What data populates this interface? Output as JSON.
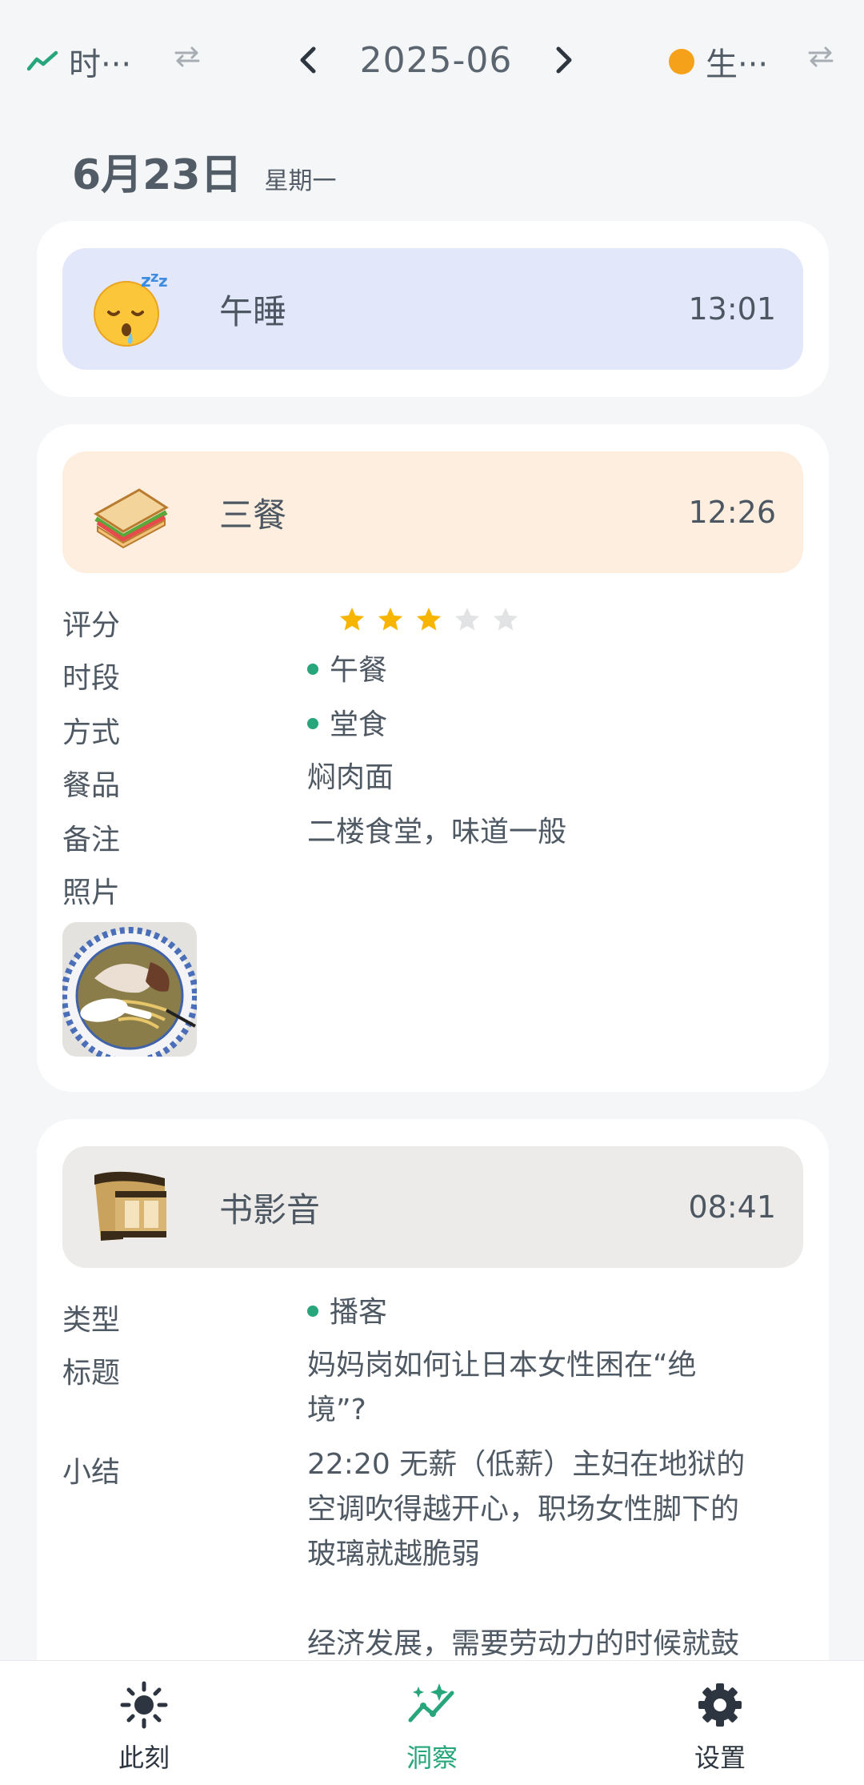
{
  "topbar": {
    "left_label": "时···",
    "month": "2025-06",
    "right_label": "生···",
    "right_dot_color": "#f5a11a",
    "accent": "#27a57b"
  },
  "date": {
    "day": "6月23日",
    "weekday": "星期一"
  },
  "nap": {
    "title": "午睡",
    "time": "13:01",
    "icon": "sleeping-face-emoji",
    "bg": "#e2e7fa"
  },
  "meal": {
    "title": "三餐",
    "time": "12:26",
    "icon": "sandwich-emoji",
    "bg": "#fdeee0",
    "rating_label": "评分",
    "rating": 3,
    "rating_max": 5,
    "period_label": "时段",
    "period": "午餐",
    "mode_label": "方式",
    "mode": "堂食",
    "dish_label": "餐品",
    "dish": "焖肉面",
    "note_label": "备注",
    "note": "二楼食堂，味道一般",
    "photo_label": "照片"
  },
  "media": {
    "title": "书影音",
    "time": "08:41",
    "icon": "film-strip-emoji",
    "bg": "#ecebe9",
    "type_label": "类型",
    "type": "播客",
    "heading_label": "标题",
    "heading_line1": "妈妈岗如何让日本女性困在“绝",
    "heading_line2": "境”?",
    "summary_label": "小结",
    "summary_line1": "22:20 无薪（低薪）主妇在地狱的",
    "summary_line2": "空调吹得越开心，职场女性脚下的",
    "summary_line3": "玻璃就越脆弱",
    "summary_line4": "经济发展，需要劳动力的时候就鼓"
  },
  "nav": {
    "items": [
      {
        "label": "此刻",
        "icon": "sun-icon"
      },
      {
        "label": "洞察",
        "icon": "trend-sparkle-icon",
        "active": true
      },
      {
        "label": "设置",
        "icon": "gear-icon"
      }
    ]
  }
}
